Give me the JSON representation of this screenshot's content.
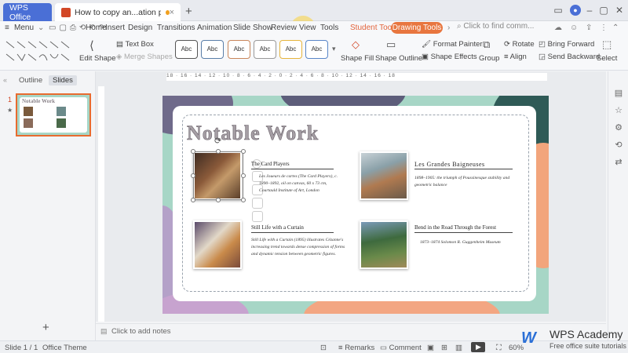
{
  "titlebar": {
    "app_tab": "WPS Office",
    "doc_tab": "How to copy an...ation painter",
    "add_tab": "+"
  },
  "menubar": {
    "menu": "Menu",
    "items": [
      "Home",
      "Insert",
      "Design",
      "Transitions",
      "Animation",
      "Slide Show",
      "Review",
      "View",
      "Tools",
      "Student Tools"
    ],
    "drawing_tools": "Drawing Tools",
    "search_placeholder": "Click to find comm..."
  },
  "ribbon": {
    "edit_shape": "Edit Shape",
    "text_box": "Text Box",
    "merge_shapes": "Merge Shapes",
    "style_label": "Abc",
    "shape_fill": "Shape Fill",
    "shape_outline": "Shape Outline",
    "format_painter": "Format Painter",
    "shape_effects": "Shape Effects",
    "group": "Group",
    "rotate": "Rotate",
    "align": "Align",
    "bring_forward": "Bring Forward",
    "send_backward": "Send Backward",
    "select": "Select"
  },
  "nav": {
    "outline_tab": "Outline",
    "slides_tab": "Slides",
    "slide_number": "1",
    "thumb_title": "Notable Work",
    "add_slide": "+"
  },
  "ruler": {
    "ticks": "18 · 16 · 14 · 12 · 10 · 8 · 6 · 4 · 2 · 0 · 2 · 4 · 6 · 8 · 10 · 12 · 14 · 16 · 18"
  },
  "slide": {
    "title": "Notable Work",
    "items": [
      {
        "title": "The Card Players",
        "desc": "Les Joueurs de cartes (The Card Players), c. 1890–1892, oil on canvas, 60 x 73 cm, Courtauld Institute of Art, London"
      },
      {
        "title": "Les Grandes Baigneuses",
        "desc": "1898–1905: the triumph of Poussinesque stability and geometric balance"
      },
      {
        "title": "Still Life with a Curtain",
        "desc": "Still Life with a Curtain (1895) illustrates Cézanne's increasing trend towards dense compression of forms and dynamic tension between geometric figures."
      },
      {
        "title": "Bend in the Road Through the Forest",
        "desc": "1873–1874 Solomon R. Guggenheim Museum"
      }
    ]
  },
  "notes": {
    "placeholder": "Click to add notes"
  },
  "status": {
    "slide_info": "Slide 1 / 1",
    "theme": "Office Theme",
    "remarks": "Remarks",
    "comment": "Comment",
    "zoom": "60%"
  },
  "watermark": {
    "brand": "WPS Academy",
    "tagline": "Free office suite tutorials"
  },
  "colors": {
    "accent": "#e8763f",
    "app_tab": "#4a6fd6",
    "slide_bg": "#a7d6c6"
  }
}
